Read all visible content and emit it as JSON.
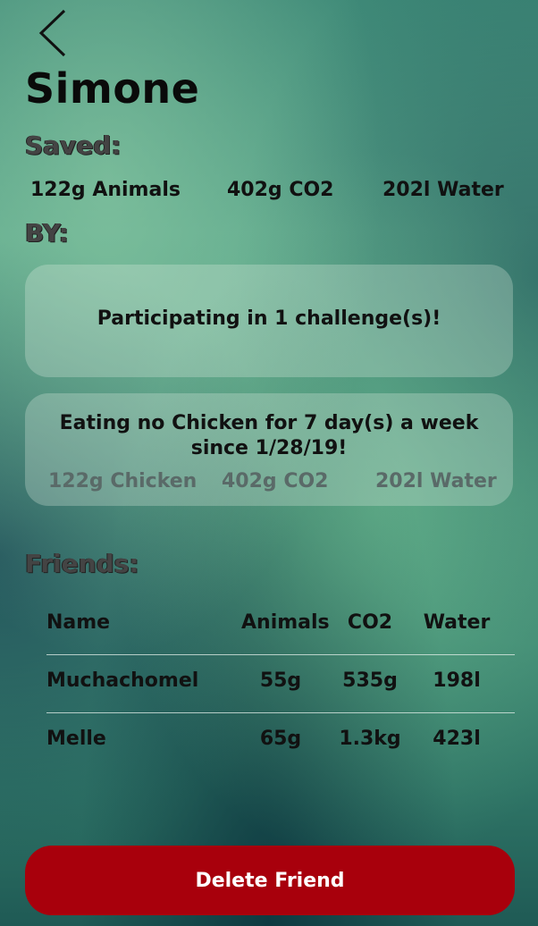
{
  "header": {
    "back_icon": "chevron-left-icon",
    "title": "Simone"
  },
  "saved": {
    "label": "Saved:",
    "animals": "122g Animals",
    "co2": "402g CO2",
    "water": "202l Water"
  },
  "by": {
    "label": "BY:",
    "participating": "Participating in 1 challenge(s)!",
    "challenge": {
      "text": "Eating no Chicken for 7 day(s) a week since 1/28/19!",
      "chicken": "122g Chicken",
      "co2": "402g CO2",
      "water": "202l Water"
    }
  },
  "friends": {
    "label": "Friends:",
    "headers": {
      "name": "Name",
      "animals": "Animals",
      "co2": "CO2",
      "water": "Water"
    },
    "rows": [
      {
        "name": "Muchachomel",
        "animals": "55g",
        "co2": "535g",
        "water": "198l"
      },
      {
        "name": "Melle",
        "animals": "65g",
        "co2": "1.3kg",
        "water": "423l"
      }
    ]
  },
  "actions": {
    "delete_label": "Delete Friend"
  },
  "colors": {
    "delete_button": "#a8000c",
    "card_bg": "rgba(230,240,230,0.28)"
  }
}
